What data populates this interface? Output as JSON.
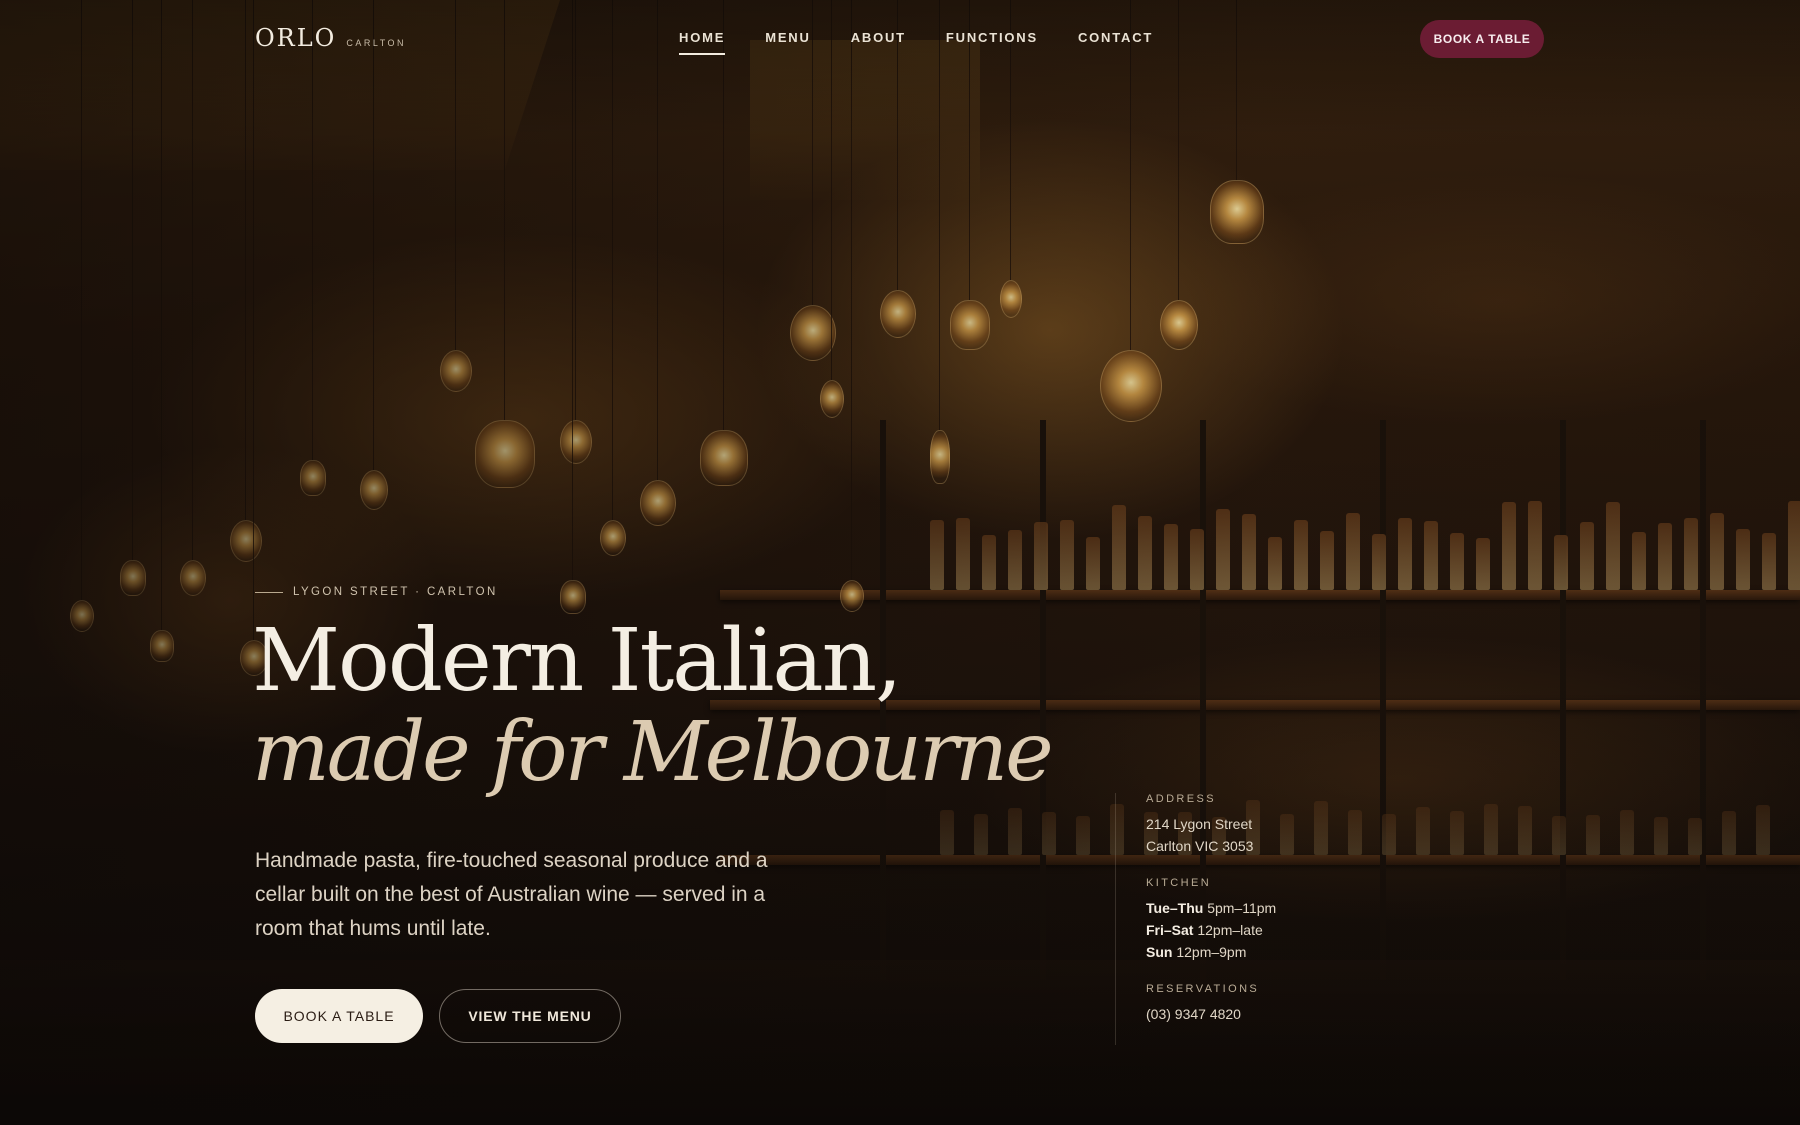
{
  "brand": {
    "name": "ORLO",
    "sub": "CARLTON"
  },
  "nav": {
    "items": [
      {
        "label": "HOME",
        "active": true
      },
      {
        "label": "MENU",
        "active": false
      },
      {
        "label": "ABOUT",
        "active": false
      },
      {
        "label": "FUNCTIONS",
        "active": false
      },
      {
        "label": "CONTACT",
        "active": false
      }
    ],
    "cta": "BOOK A TABLE"
  },
  "hero": {
    "eyebrow": "LYGON STREET · CARLTON",
    "headline_line1": "Modern Italian,",
    "headline_line2": "made for Melbourne",
    "lede": "Handmade pasta, fire-touched seasonal produce and a cellar built on the best of Australian wine — served in a room that hums until late.",
    "primary_button": "BOOK A TABLE",
    "secondary_button": "VIEW THE MENU"
  },
  "info": {
    "address": {
      "label": "ADDRESS",
      "line1": "214 Lygon Street",
      "line2": "Carlton VIC 3053"
    },
    "kitchen": {
      "label": "KITCHEN",
      "rows": [
        {
          "days": "Tue–Thu",
          "hours": "5pm–11pm"
        },
        {
          "days": "Fri–Sat",
          "hours": "12pm–late"
        },
        {
          "days": "Sun",
          "hours": "12pm–9pm"
        }
      ]
    },
    "reservations": {
      "label": "RESERVATIONS",
      "phone": "(03) 9347 4820"
    }
  },
  "colors": {
    "accent": "#6b1c33",
    "cream": "#f5efe3",
    "text": "#f4eee3"
  }
}
